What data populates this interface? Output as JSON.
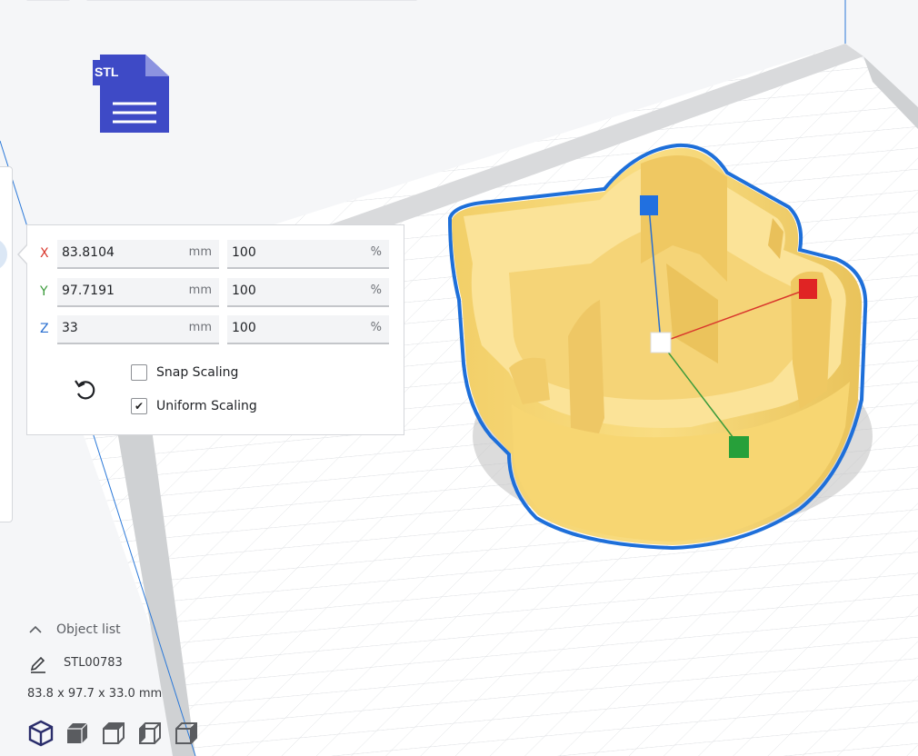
{
  "file_icon": {
    "label": "STL"
  },
  "scale_panel": {
    "rows": [
      {
        "axis": "X",
        "axis_color": "#d9372c",
        "mm_value": "83.8104",
        "mm_unit": "mm",
        "pct_value": "100",
        "pct_unit": "%"
      },
      {
        "axis": "Y",
        "axis_color": "#3a9a3a",
        "mm_value": "97.7191",
        "mm_unit": "mm",
        "pct_value": "100",
        "pct_unit": "%"
      },
      {
        "axis": "Z",
        "axis_color": "#2a6fd0",
        "mm_value": "33",
        "mm_unit": "mm",
        "pct_value": "100",
        "pct_unit": "%"
      }
    ],
    "snap_scaling": {
      "label": "Snap Scaling",
      "checked": false
    },
    "uniform_scaling": {
      "label": "Uniform Scaling",
      "checked": true,
      "checkmark": "✔"
    },
    "reset_icon": "rotate-ccw-icon"
  },
  "object_list": {
    "header_label": "Object list",
    "object_name": "STL00783",
    "dimensions": "83.8 x 97.7 x 33.0 mm"
  },
  "view_buttons": [
    "3d-view",
    "front-view",
    "top-view",
    "left-view",
    "right-view"
  ],
  "colors": {
    "model_fill": "#f8d978",
    "model_outline": "#1e6fd9",
    "build_plate": "#ffffff",
    "grid": "#dfe1e4",
    "plate_border": "#c5c7ca",
    "accent": "#2a2d6b"
  }
}
